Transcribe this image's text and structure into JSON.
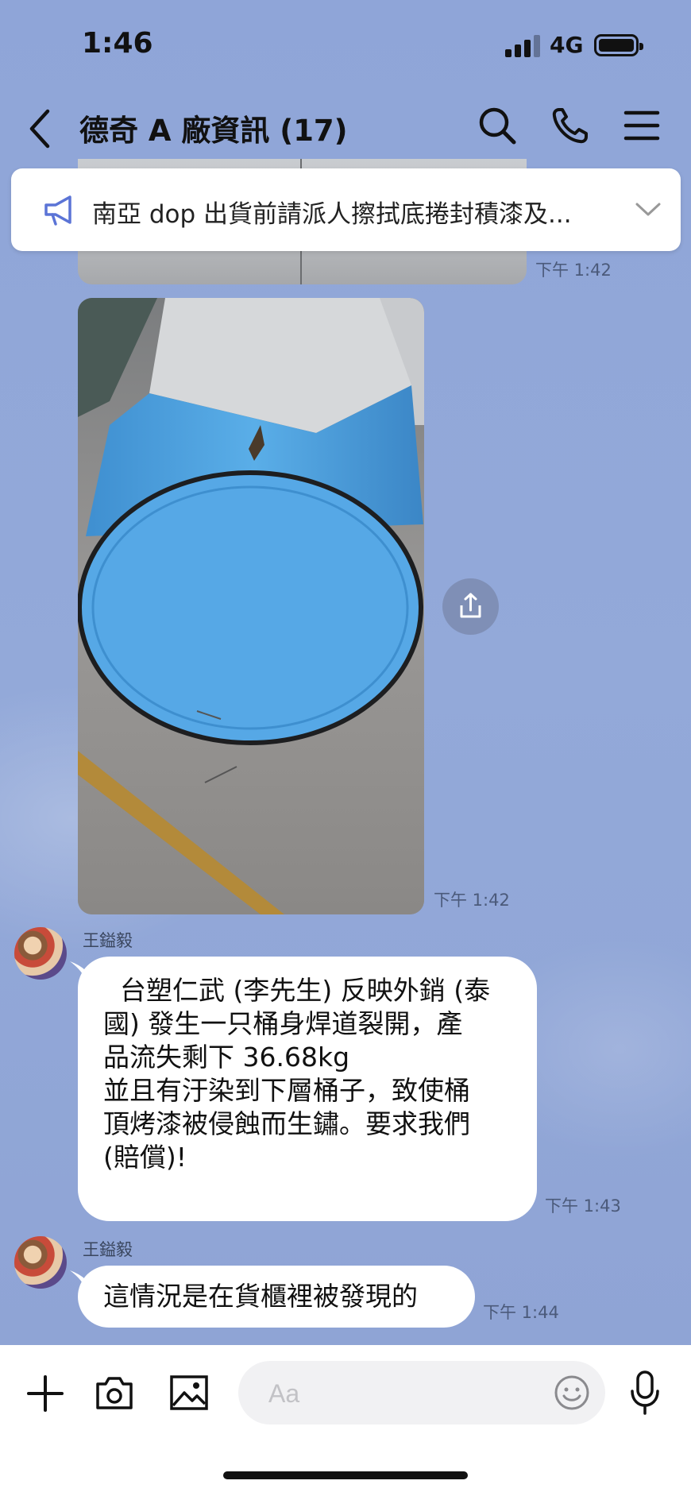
{
  "status_bar": {
    "time": "1:46",
    "network": "4G",
    "signal_bars": 3
  },
  "header": {
    "title": "德奇 A 廠資訊 (17)",
    "back_icon": "chevron-left-icon",
    "search_icon": "search-icon",
    "call_icon": "phone-icon",
    "menu_icon": "menu-icon"
  },
  "announcement": {
    "text": "南亞 dop 出貨前請派人擦拭底捲封積漆及...",
    "icon": "megaphone-icon"
  },
  "messages": [
    {
      "type": "image",
      "time": "下午 1:42"
    },
    {
      "type": "image",
      "time": "下午 1:42"
    },
    {
      "type": "text",
      "sender": "王鎰毅",
      "time": "下午 1:43",
      "text": "  台塑仁武 (李先生) 反映外銷 (泰\n國) 發生一只桶身焊道裂開，產\n品流失剩下 36.68kg\n並且有汙染到下層桶子，致使桶\n頂烤漆被侵蝕而生鏽。要求我們\n(賠償)!"
    },
    {
      "type": "text",
      "sender": "王鎰毅",
      "time": "下午 1:44",
      "text": "這情況是在貨櫃裡被發現的"
    }
  ],
  "composer": {
    "placeholder": "Aa"
  },
  "colors": {
    "background": "#8ea4d6",
    "bubble": "#ffffff",
    "accent": "#5b74d6"
  }
}
